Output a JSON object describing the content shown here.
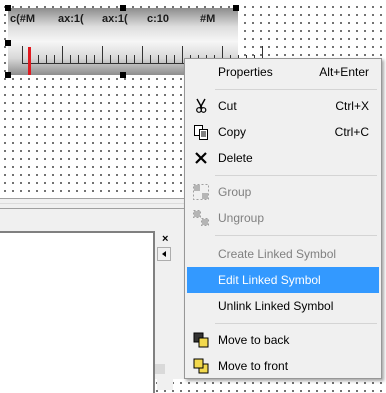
{
  "gauge": {
    "labels": [
      "c(#M",
      "ax:1(",
      "ax:1(",
      "c:10",
      "#M"
    ],
    "major_ticks": 7,
    "minor_per_major": 4
  },
  "menu": {
    "highlight_color": "#3399ff",
    "items": [
      {
        "label": "Properties",
        "shortcut": "Alt+Enter",
        "icon": "",
        "state": "normal"
      },
      {
        "label": "Cut",
        "shortcut": "Ctrl+X",
        "icon": "scissors-icon",
        "state": "normal"
      },
      {
        "label": "Copy",
        "shortcut": "Ctrl+C",
        "icon": "copy-icon",
        "state": "normal"
      },
      {
        "label": "Delete",
        "shortcut": "",
        "icon": "delete-x-icon",
        "state": "normal"
      },
      {
        "label": "Group",
        "shortcut": "",
        "icon": "group-icon",
        "state": "disabled"
      },
      {
        "label": "Ungroup",
        "shortcut": "",
        "icon": "ungroup-icon",
        "state": "disabled"
      },
      {
        "label": "Create Linked Symbol",
        "shortcut": "",
        "icon": "",
        "state": "disabled"
      },
      {
        "label": "Edit Linked Symbol",
        "shortcut": "",
        "icon": "",
        "state": "highlighted"
      },
      {
        "label": "Unlink Linked Symbol",
        "shortcut": "",
        "icon": "",
        "state": "normal"
      },
      {
        "label": "Move to back",
        "shortcut": "",
        "icon": "move-to-back-icon",
        "state": "normal"
      },
      {
        "label": "Move to front",
        "shortcut": "",
        "icon": "move-to-front-icon",
        "state": "normal"
      }
    ]
  },
  "panel": {
    "close_glyph": "×"
  }
}
